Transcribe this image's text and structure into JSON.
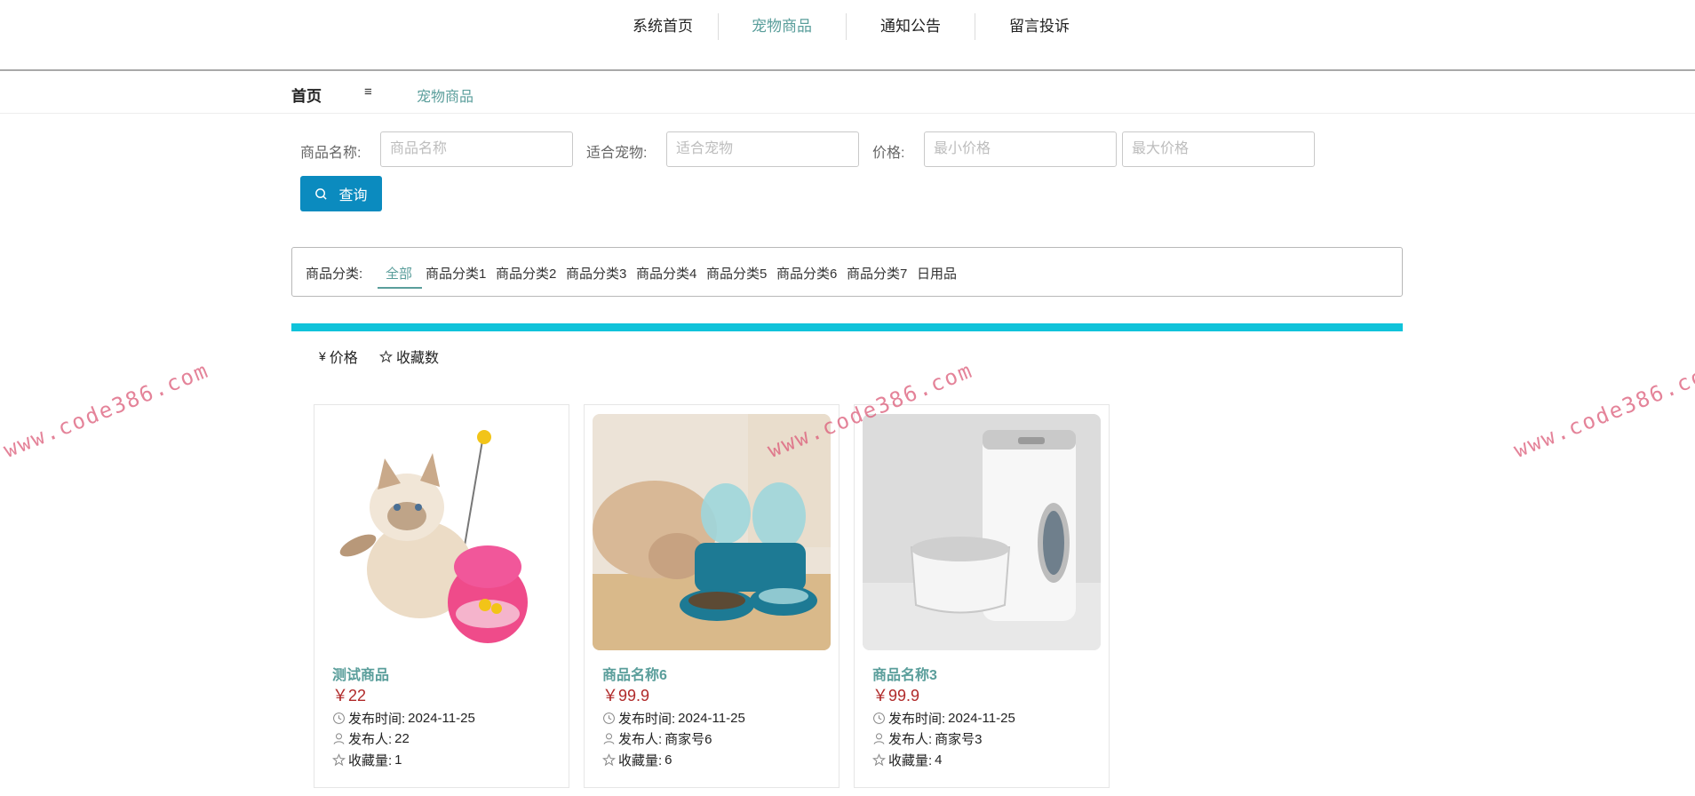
{
  "nav": {
    "items": [
      {
        "label": "系统首页",
        "active": false
      },
      {
        "label": "宠物商品",
        "active": true
      },
      {
        "label": "通知公告",
        "active": false
      },
      {
        "label": "留言投诉",
        "active": false
      }
    ]
  },
  "breadcrumb": {
    "home": "首页",
    "separator": "≡",
    "current": "宠物商品"
  },
  "search": {
    "name_label": "商品名称:",
    "name_placeholder": "商品名称",
    "pet_label": "适合宠物:",
    "pet_placeholder": "适合宠物",
    "price_label": "价格:",
    "min_placeholder": "最小价格",
    "max_placeholder": "最大价格",
    "button_label": "查询"
  },
  "categories": {
    "label": "商品分类:",
    "items": [
      "全部",
      "商品分类1",
      "商品分类2",
      "商品分类3",
      "商品分类4",
      "商品分类5",
      "商品分类6",
      "商品分类7",
      "日用品"
    ],
    "selected": "全部"
  },
  "sort": {
    "price_label": "价格",
    "fav_label": "收藏数",
    "currency_icon": "¥"
  },
  "products": [
    {
      "title": "测试商品",
      "price": "￥22",
      "time_label": "发布时间:",
      "time": "2024-11-25",
      "publisher_label": "发布人:",
      "publisher": "22",
      "fav_label": "收藏量:",
      "fav": "1",
      "image": "cat-with-toy-photo"
    },
    {
      "title": "商品名称6",
      "price": "￥99.9",
      "time_label": "发布时间:",
      "time": "2024-11-25",
      "publisher_label": "发布人:",
      "publisher": "商家号6",
      "fav_label": "收藏量:",
      "fav": "6",
      "image": "dog-feeder-photo"
    },
    {
      "title": "商品名称3",
      "price": "￥99.9",
      "time_label": "发布时间:",
      "time": "2024-11-25",
      "publisher_label": "发布人:",
      "publisher": "商家号3",
      "fav_label": "收藏量:",
      "fav": "4",
      "image": "auto-feeder-photo"
    }
  ],
  "watermark": "www.code386.com",
  "colors": {
    "accent": "#5a9e9b",
    "button": "#0b8bbf",
    "cyan_bar": "#10c3da",
    "price": "#b02929"
  }
}
